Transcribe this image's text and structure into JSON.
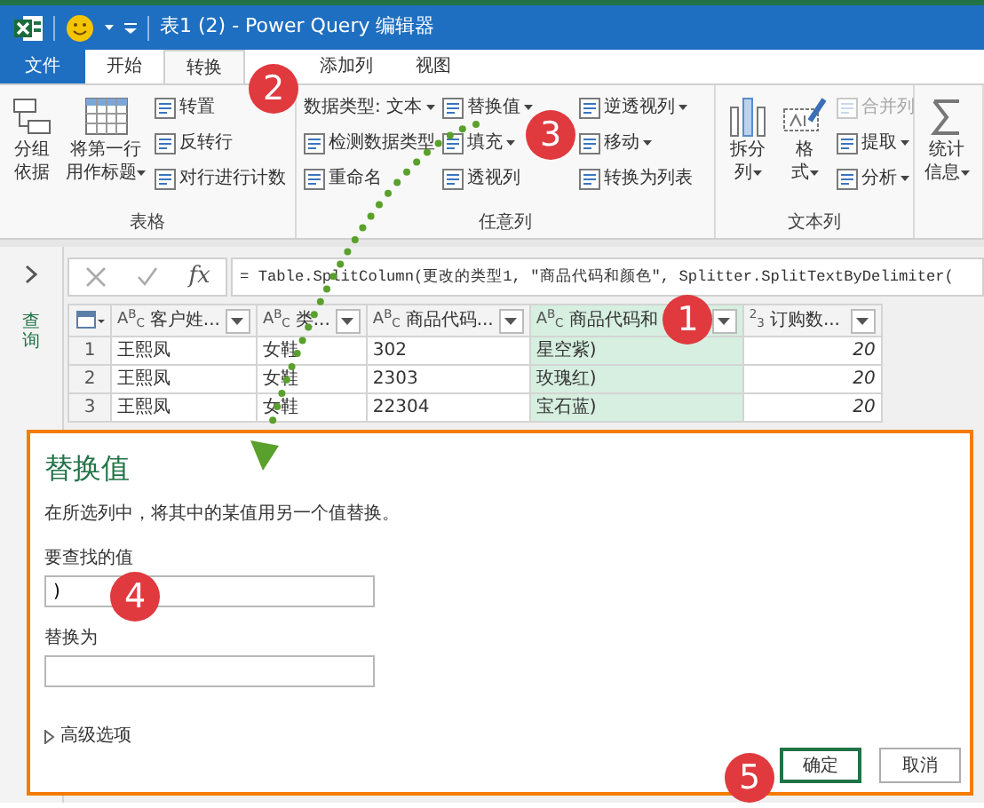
{
  "window": {
    "title": "表1 (2) - Power Query 编辑器"
  },
  "ribbon_tabs": [
    {
      "label": "文件",
      "kind": "file",
      "selected": false
    },
    {
      "label": "开始",
      "kind": "tab",
      "selected": false
    },
    {
      "label": "转换",
      "kind": "tab",
      "selected": true
    },
    {
      "label": "添加列",
      "kind": "tab",
      "selected": false
    },
    {
      "label": "视图",
      "kind": "tab",
      "selected": false
    }
  ],
  "ribbon_groups": [
    {
      "label": "表格",
      "columns": [
        {
          "kind": "large",
          "lines": [
            "分组",
            "依据"
          ],
          "dropdown": false
        },
        {
          "kind": "large",
          "lines": [
            "将第一行",
            "用作标题"
          ],
          "dropdown": true
        },
        {
          "kind": "stack",
          "items": [
            {
              "label": "转置",
              "kind": "command",
              "dropdown": false,
              "disabled": false
            },
            {
              "label": "反转行",
              "kind": "command",
              "dropdown": false,
              "disabled": false
            },
            {
              "label": "对行进行计数",
              "kind": "command",
              "dropdown": false,
              "disabled": false
            }
          ]
        }
      ]
    },
    {
      "label": "任意列",
      "columns": [
        {
          "kind": "stack",
          "items": [
            {
              "label": "数据类型: 文本",
              "kind": "select",
              "dropdown": true,
              "disabled": false
            },
            {
              "label": "检测数据类型",
              "kind": "command",
              "dropdown": false,
              "disabled": false
            },
            {
              "label": "重命名",
              "kind": "command",
              "dropdown": false,
              "disabled": false
            }
          ]
        },
        {
          "kind": "stack",
          "items": [
            {
              "label": "替换值",
              "kind": "command",
              "dropdown": true,
              "disabled": false
            },
            {
              "label": "填充",
              "kind": "command",
              "dropdown": true,
              "disabled": false
            },
            {
              "label": "透视列",
              "kind": "command",
              "dropdown": false,
              "disabled": false
            }
          ]
        },
        {
          "kind": "stack",
          "items": [
            {
              "label": "逆透视列",
              "kind": "command",
              "dropdown": true,
              "disabled": false
            },
            {
              "label": "移动",
              "kind": "command",
              "dropdown": true,
              "disabled": false
            },
            {
              "label": "转换为列表",
              "kind": "command",
              "dropdown": false,
              "disabled": false
            }
          ]
        }
      ]
    },
    {
      "label": "文本列",
      "columns": [
        {
          "kind": "large",
          "lines": [
            "拆分",
            "列"
          ],
          "dropdown": true
        },
        {
          "kind": "large",
          "lines": [
            "格",
            "式"
          ],
          "dropdown": true
        },
        {
          "kind": "stack",
          "items": [
            {
              "label": "合并列",
              "kind": "command",
              "dropdown": false,
              "disabled": true
            },
            {
              "label": "提取",
              "kind": "command",
              "dropdown": true,
              "disabled": false
            },
            {
              "label": "分析",
              "kind": "command",
              "dropdown": true,
              "disabled": false
            }
          ]
        }
      ]
    },
    {
      "columns": [
        {
          "kind": "large",
          "lines": [
            "统计",
            "信息"
          ],
          "dropdown": true
        }
      ]
    }
  ],
  "query_pane": {
    "label": "查询",
    "expanded": false
  },
  "formula_bar": {
    "fx": "fx",
    "formula": "= Table.SplitColumn(更改的类型1, \"商品代码和颜色\", Splitter.SplitTextByDelimiter("
  },
  "table": {
    "columns": [
      {
        "type": "A$^{B}$$_{C}$",
        "name": "客户姓...",
        "kind": "text",
        "selected": false
      },
      {
        "type": "A$^{B}$$_{C}$",
        "name": "类...",
        "kind": "text",
        "selected": false
      },
      {
        "type": "A$^{B}$$_{C}$",
        "name": "商品代码...",
        "kind": "text",
        "selected": false
      },
      {
        "type": "A$^{B}$$_{C}$",
        "name": "商品代码和",
        "kind": "text",
        "selected": true
      },
      {
        "type": "$^{2}$$_{3}$",
        "name": "订购数...",
        "kind": "number",
        "selected": false
      }
    ],
    "rows": [
      {
        "number": "1",
        "cells": [
          "王熙凤",
          "女鞋",
          "302",
          "星空紫)",
          "20"
        ]
      },
      {
        "number": "2",
        "cells": [
          "王熙凤",
          "女鞋",
          "2303",
          "玫瑰红)",
          "20"
        ]
      },
      {
        "number": "3",
        "cells": [
          "王熙凤",
          "女鞋",
          "22304",
          "宝石蓝)",
          "20"
        ]
      }
    ]
  },
  "dialog": {
    "title": "替换值",
    "description": "在所选列中，将其中的某值用另一个值替换。",
    "fields": [
      {
        "label": "要查找的值",
        "value": ")"
      },
      {
        "label": "替换为"
      }
    ],
    "advanced": {
      "label": "高级选项",
      "expanded": false
    },
    "buttons": [
      {
        "label": "确定",
        "kind": "primary"
      },
      {
        "label": "取消",
        "kind": "secondary"
      }
    ]
  },
  "callouts": [
    "1",
    "2",
    "3",
    "4",
    "5"
  ]
}
